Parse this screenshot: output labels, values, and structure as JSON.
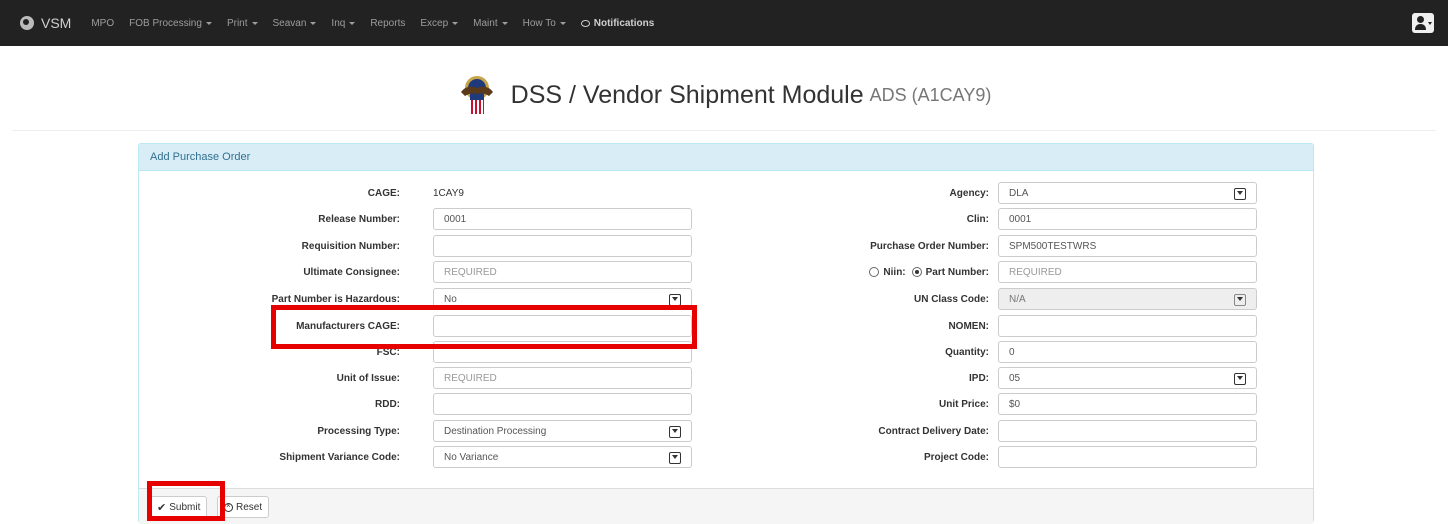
{
  "navbar": {
    "brand": "VSM",
    "items": [
      {
        "label": "MPO",
        "dropdown": false
      },
      {
        "label": "FOB Processing",
        "dropdown": true
      },
      {
        "label": "Print",
        "dropdown": true
      },
      {
        "label": "Seavan",
        "dropdown": true
      },
      {
        "label": "Inq",
        "dropdown": true
      },
      {
        "label": "Reports",
        "dropdown": false
      },
      {
        "label": "Excep",
        "dropdown": true
      },
      {
        "label": "Maint",
        "dropdown": true
      },
      {
        "label": "How To",
        "dropdown": true
      }
    ],
    "notifications": "Notifications",
    "user_icon": "user-icon"
  },
  "header": {
    "title": "DSS / Vendor Shipment Module",
    "subtitle": "ADS (A1CAY9)",
    "logo_icon": "dla-seal-icon"
  },
  "panel": {
    "heading": "Add Purchase Order",
    "left": {
      "cage_label": "CAGE:",
      "cage_value": "1CAY9",
      "release_label": "Release Number:",
      "release_value": "0001",
      "requisition_label": "Requisition Number:",
      "requisition_value": "",
      "consignee_label": "Ultimate Consignee:",
      "consignee_placeholder": "REQUIRED",
      "hazardous_label": "Part Number is Hazardous:",
      "hazardous_value": "No",
      "mfr_cage_label": "Manufacturers CAGE:",
      "mfr_cage_value": "",
      "fsc_label": "FSC:",
      "fsc_value": "",
      "uoi_label": "Unit of Issue:",
      "uoi_placeholder": "REQUIRED",
      "rdd_label": "RDD:",
      "rdd_value": "",
      "proc_type_label": "Processing Type:",
      "proc_type_value": "Destination Processing",
      "variance_label": "Shipment Variance Code:",
      "variance_value": "No Variance"
    },
    "right": {
      "agency_label": "Agency:",
      "agency_value": "DLA",
      "clin_label": "Clin:",
      "clin_value": "0001",
      "po_label": "Purchase Order Number:",
      "po_value": "SPM500TESTWRS",
      "niin_label": "Niin:",
      "part_label": "Part Number:",
      "part_placeholder": "REQUIRED",
      "un_label": "UN Class Code:",
      "un_value": "N/A",
      "nomen_label": "NOMEN:",
      "nomen_value": "",
      "qty_label": "Quantity:",
      "qty_value": "0",
      "ipd_label": "IPD:",
      "ipd_value": "05",
      "price_label": "Unit Price:",
      "price_value": "$0",
      "cdd_label": "Contract Delivery Date:",
      "cdd_value": "",
      "project_label": "Project Code:",
      "project_value": ""
    },
    "footer": {
      "submit_label": "Submit",
      "reset_label": "Reset"
    }
  },
  "colors": {
    "navbar_bg": "#222222",
    "panel_heading_bg": "#d9edf7",
    "highlight": "#e60000"
  }
}
